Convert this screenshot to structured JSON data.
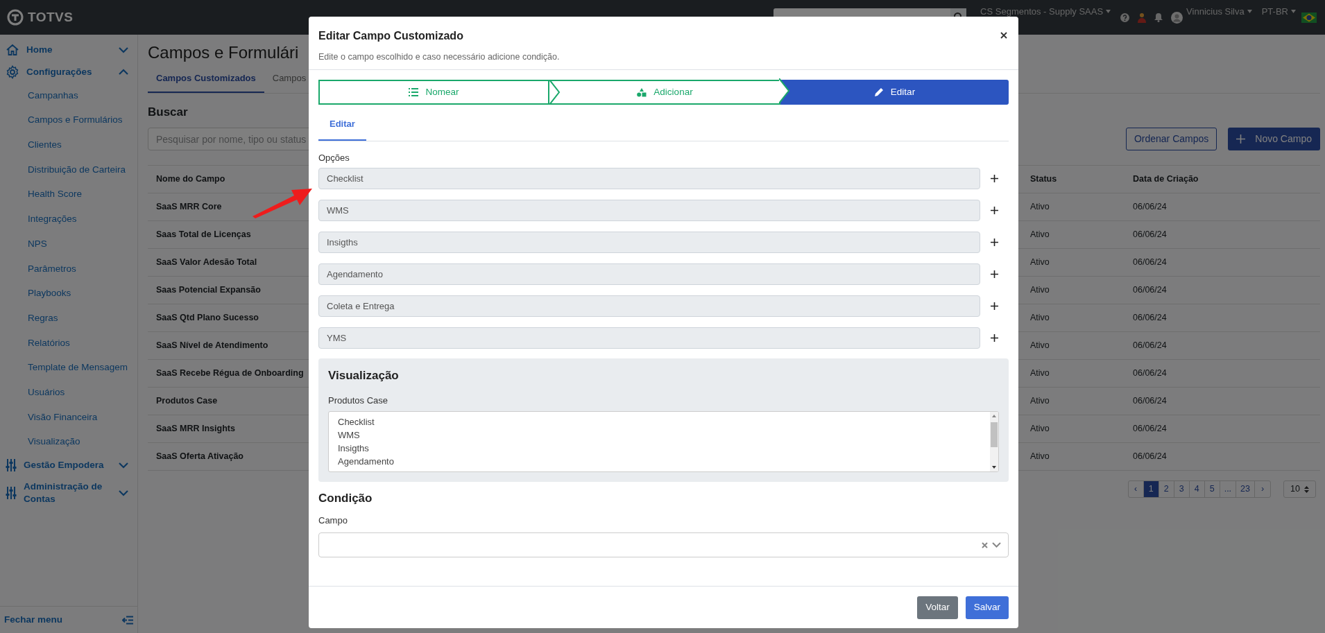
{
  "top_bar": {
    "logo": "TOTVS",
    "workspace": "CS Segmentos - Supply SAAS",
    "user": "Vinnicius Silva",
    "language": "PT-BR"
  },
  "sidebar": {
    "items": [
      {
        "label": "Home",
        "expanded": false
      },
      {
        "label": "Configurações",
        "expanded": true,
        "children": [
          {
            "label": "Campanhas"
          },
          {
            "label": "Campos e Formulários"
          },
          {
            "label": "Clientes"
          },
          {
            "label": "Distribuição de Carteira"
          },
          {
            "label": "Health Score"
          },
          {
            "label": "Integrações"
          },
          {
            "label": "NPS"
          },
          {
            "label": "Parâmetros"
          },
          {
            "label": "Playbooks"
          },
          {
            "label": "Regras"
          },
          {
            "label": "Relatórios"
          },
          {
            "label": "Template de Mensagem"
          },
          {
            "label": "Usuários"
          },
          {
            "label": "Visão Financeira"
          },
          {
            "label": "Visualização"
          }
        ]
      },
      {
        "label": "Gestão Empodera",
        "expanded": false
      },
      {
        "label": "Administração de Contas",
        "expanded": false
      }
    ],
    "footer": "Fechar menu"
  },
  "page": {
    "title": "Campos e Formulári",
    "tabs": [
      {
        "label": "Campos Customizados",
        "selected": true
      },
      {
        "label": "Campos",
        "selected": false
      }
    ],
    "search_label": "Buscar",
    "search_placeholder": "Pesquisar por nome, tipo ou status",
    "buttons": [
      {
        "label": "Ordenar Campos",
        "kind": "outline"
      },
      {
        "label": "Novo Campo",
        "kind": "primary"
      }
    ],
    "table": {
      "columns": [
        "Nome do Campo",
        "Status",
        "Data de Criação"
      ],
      "rows": [
        [
          "SaaS MRR Core",
          "Ativo",
          "06/06/24"
        ],
        [
          "Saas Total de Licenças",
          "Ativo",
          "06/06/24"
        ],
        [
          "SaaS Valor Adesão Total",
          "Ativo",
          "06/06/24"
        ],
        [
          "Saas Potencial Expansão",
          "Ativo",
          "06/06/24"
        ],
        [
          "SaaS Qtd Plano Sucesso",
          "Ativo",
          "06/06/24"
        ],
        [
          "SaaS Nível de Atendimento",
          "Ativo",
          "06/06/24"
        ],
        [
          "SaaS Recebe Régua de Onboarding",
          "Ativo",
          "06/06/24"
        ],
        [
          "Produtos Case",
          "Ativo",
          "06/06/24"
        ],
        [
          "SaaS MRR Insights",
          "Ativo",
          "06/06/24"
        ],
        [
          "SaaS Oferta Ativação",
          "Ativo",
          "06/06/24"
        ]
      ]
    },
    "pagination": [
      {
        "label": "‹",
        "selected": false
      },
      {
        "label": "1",
        "selected": true
      },
      {
        "label": "2",
        "selected": false
      },
      {
        "label": "3",
        "selected": false
      },
      {
        "label": "4",
        "selected": false
      },
      {
        "label": "5",
        "selected": false
      },
      {
        "label": "...",
        "selected": false
      },
      {
        "label": "23",
        "selected": false
      },
      {
        "label": "›",
        "selected": false
      }
    ],
    "page_size": "10"
  },
  "modal": {
    "title": "Editar Campo Customizado",
    "subtitle": "Edite o campo escolhido e caso necessário adicione condição.",
    "steps": [
      {
        "label": "Nomear",
        "selected": false
      },
      {
        "label": "Adicionar",
        "selected": false
      },
      {
        "label": "Editar",
        "selected": true
      }
    ],
    "tabs": [
      {
        "label": "Editar",
        "selected": true
      }
    ],
    "options_label": "Opções",
    "options": [
      "Checklist",
      "WMS",
      "Insigths",
      "Agendamento",
      "Coleta e Entrega",
      "YMS"
    ],
    "preview": {
      "title": "Visualização",
      "label": "Produtos Case",
      "items": [
        "Checklist",
        "WMS",
        "Insigths",
        "Agendamento"
      ]
    },
    "condition": {
      "title": "Condição",
      "field_label": "Campo"
    },
    "buttons": [
      {
        "label": "Voltar",
        "kind": "secondary"
      },
      {
        "label": "Salvar",
        "kind": "primary"
      }
    ]
  }
}
